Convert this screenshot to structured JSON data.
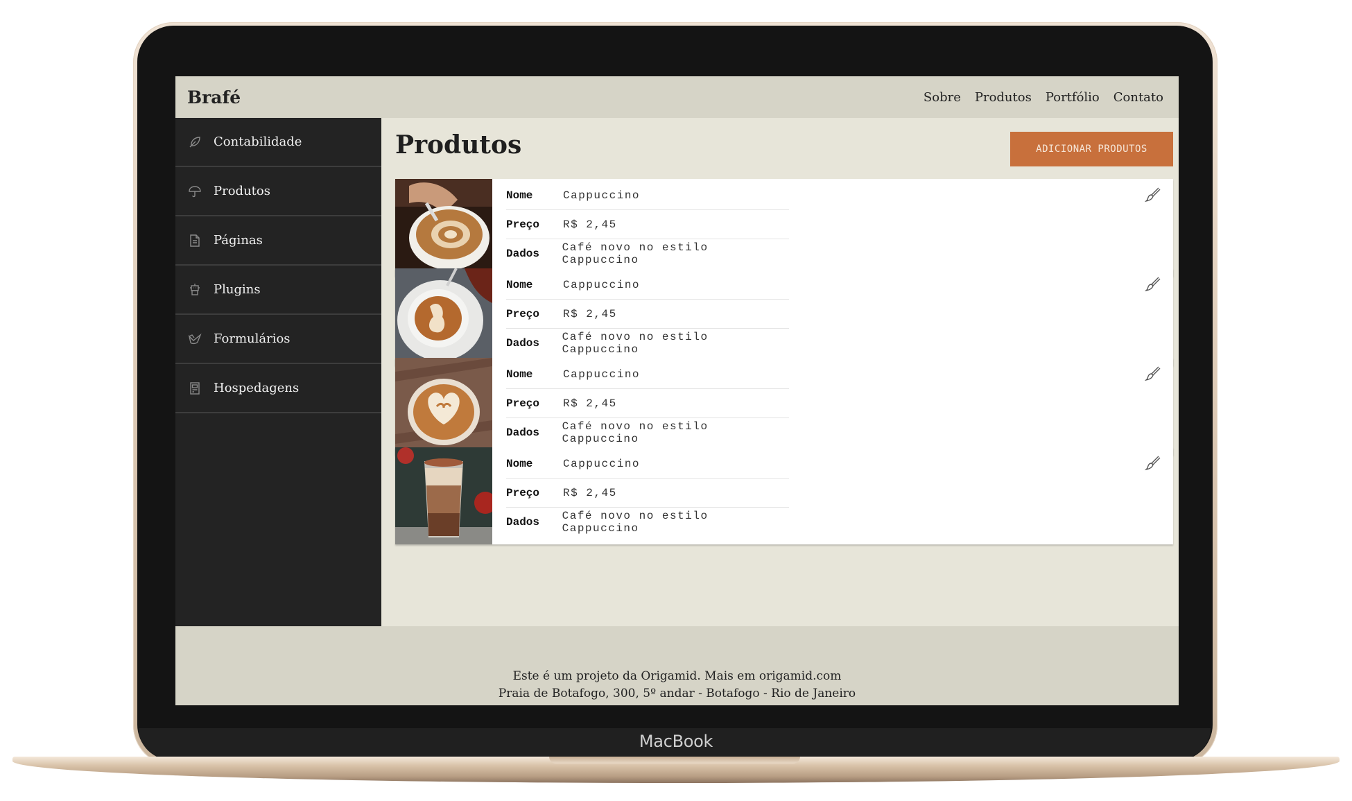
{
  "device": {
    "label": "MacBook"
  },
  "header": {
    "logo": "Brafé",
    "nav": [
      "Sobre",
      "Produtos",
      "Portfólio",
      "Contato"
    ]
  },
  "sidebar": {
    "items": [
      {
        "label": "Contabilidade",
        "icon": "feather-icon"
      },
      {
        "label": "Produtos",
        "icon": "umbrella-icon"
      },
      {
        "label": "Páginas",
        "icon": "document-icon"
      },
      {
        "label": "Plugins",
        "icon": "robot-icon"
      },
      {
        "label": "Formulários",
        "icon": "bird-icon"
      },
      {
        "label": "Hospedagens",
        "icon": "server-icon"
      }
    ]
  },
  "main": {
    "title": "Produtos",
    "add_button": "ADICIONAR PRODUTOS",
    "products": [
      {
        "name_label": "Nome",
        "name": "Cappuccino",
        "price_label": "Preço",
        "price": "R$ 2,45",
        "data_label": "Dados",
        "data": "Café novo no estilo Cappuccino",
        "image": "latte-art-pour"
      },
      {
        "name_label": "Nome",
        "name": "Cappuccino",
        "price_label": "Preço",
        "price": "R$ 2,45",
        "data_label": "Dados",
        "data": "Café novo no estilo Cappuccino",
        "image": "latte-art-saucer"
      },
      {
        "name_label": "Nome",
        "name": "Cappuccino",
        "price_label": "Preço",
        "price": "R$ 2,45",
        "data_label": "Dados",
        "data": "Café novo no estilo Cappuccino",
        "image": "latte-art-wood"
      },
      {
        "name_label": "Nome",
        "name": "Cappuccino",
        "price_label": "Preço",
        "price": "R$ 2,45",
        "data_label": "Dados",
        "data": "Café novo no estilo Cappuccino",
        "image": "layered-glass"
      }
    ]
  },
  "footer": {
    "line1": "Este é um projeto da Origamid. Mais em origamid.com",
    "line2": "Praia de Botafogo, 300, 5º andar - Botafogo - Rio de Janeiro"
  },
  "colors": {
    "accent": "#c8703c",
    "header_bg": "#d6d4c7",
    "content_bg": "#e7e5d9",
    "sidebar_bg": "#232323"
  }
}
